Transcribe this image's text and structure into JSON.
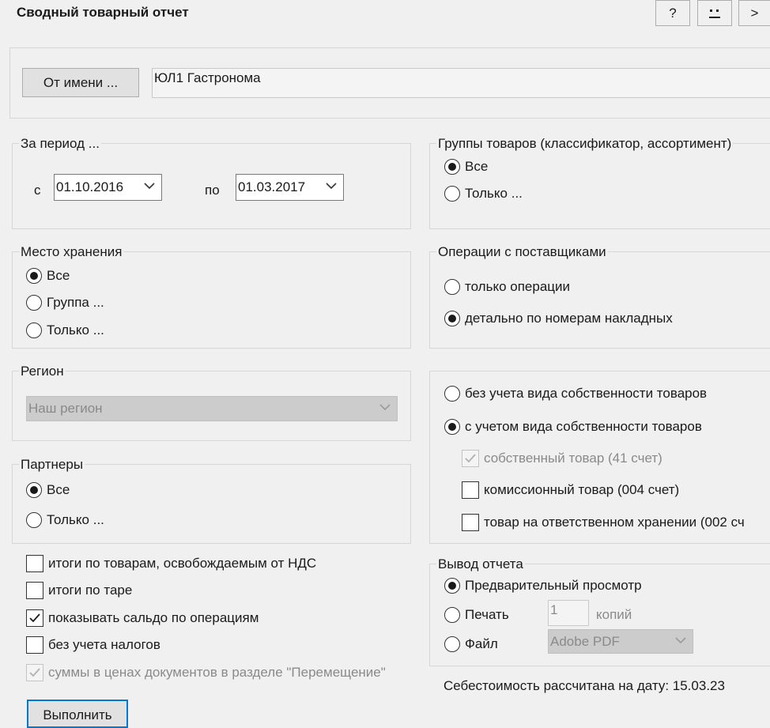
{
  "window": {
    "title": "Сводный товарный отчет",
    "help_label": "?",
    "next_label": ">"
  },
  "sender": {
    "button_label": "От имени ...",
    "value": "ЮЛ1 Гастронома"
  },
  "period": {
    "legend": "За период ...",
    "from_label": "с",
    "from_value": "01.10.2016",
    "to_label": "по",
    "to_value": "01.03.2017"
  },
  "product_groups": {
    "legend": "Группы товаров (классификатор, ассортимент)",
    "options": [
      {
        "label": "Все",
        "selected": true
      },
      {
        "label": "Только ...",
        "selected": false
      }
    ]
  },
  "storage": {
    "legend": "Место хранения",
    "options": [
      {
        "label": "Все",
        "selected": true
      },
      {
        "label": "Группа ...",
        "selected": false
      },
      {
        "label": "Только ...",
        "selected": false
      }
    ]
  },
  "supplier_ops": {
    "legend": "Операции с поставщиками",
    "options": [
      {
        "label": "только операции",
        "selected": false
      },
      {
        "label": "детально по номерам накладных",
        "selected": true
      }
    ]
  },
  "region": {
    "legend": "Регион",
    "value": "Наш регион"
  },
  "ownership": {
    "options": [
      {
        "label": "без учета вида собственности товаров",
        "selected": false
      },
      {
        "label": "с учетом вида собственности товаров",
        "selected": true
      }
    ],
    "checks": [
      {
        "label": "собственный товар (41 счет)",
        "checked": true,
        "disabled": true
      },
      {
        "label": "комиссионный товар (004 счет)",
        "checked": false,
        "disabled": false
      },
      {
        "label": "товар на ответственном хранении (002 сч",
        "checked": false,
        "disabled": false
      }
    ]
  },
  "partners": {
    "legend": "Партнеры",
    "options": [
      {
        "label": "Все",
        "selected": true
      },
      {
        "label": "Только ...",
        "selected": false
      }
    ]
  },
  "flags": [
    {
      "label": "итоги по товарам, освобождаемым от НДС",
      "checked": false,
      "disabled": false
    },
    {
      "label": "итоги по таре",
      "checked": false,
      "disabled": false
    },
    {
      "label": "показывать сальдо по операциям",
      "checked": true,
      "disabled": false
    },
    {
      "label": "без учета налогов",
      "checked": false,
      "disabled": false
    },
    {
      "label": "суммы в ценах документов в разделе \"Перемещение\"",
      "checked": true,
      "disabled": true
    }
  ],
  "output": {
    "legend": "Вывод отчета",
    "options": [
      {
        "label": "Предварительный просмотр",
        "selected": true
      },
      {
        "label": "Печать",
        "selected": false
      },
      {
        "label": "Файл",
        "selected": false
      }
    ],
    "copies_value": "1",
    "copies_label": "копий",
    "file_format": "Adobe PDF"
  },
  "cost_note": "Себестоимость рассчитана на дату: 15.03.23",
  "run_button_label": "Выполнить"
}
